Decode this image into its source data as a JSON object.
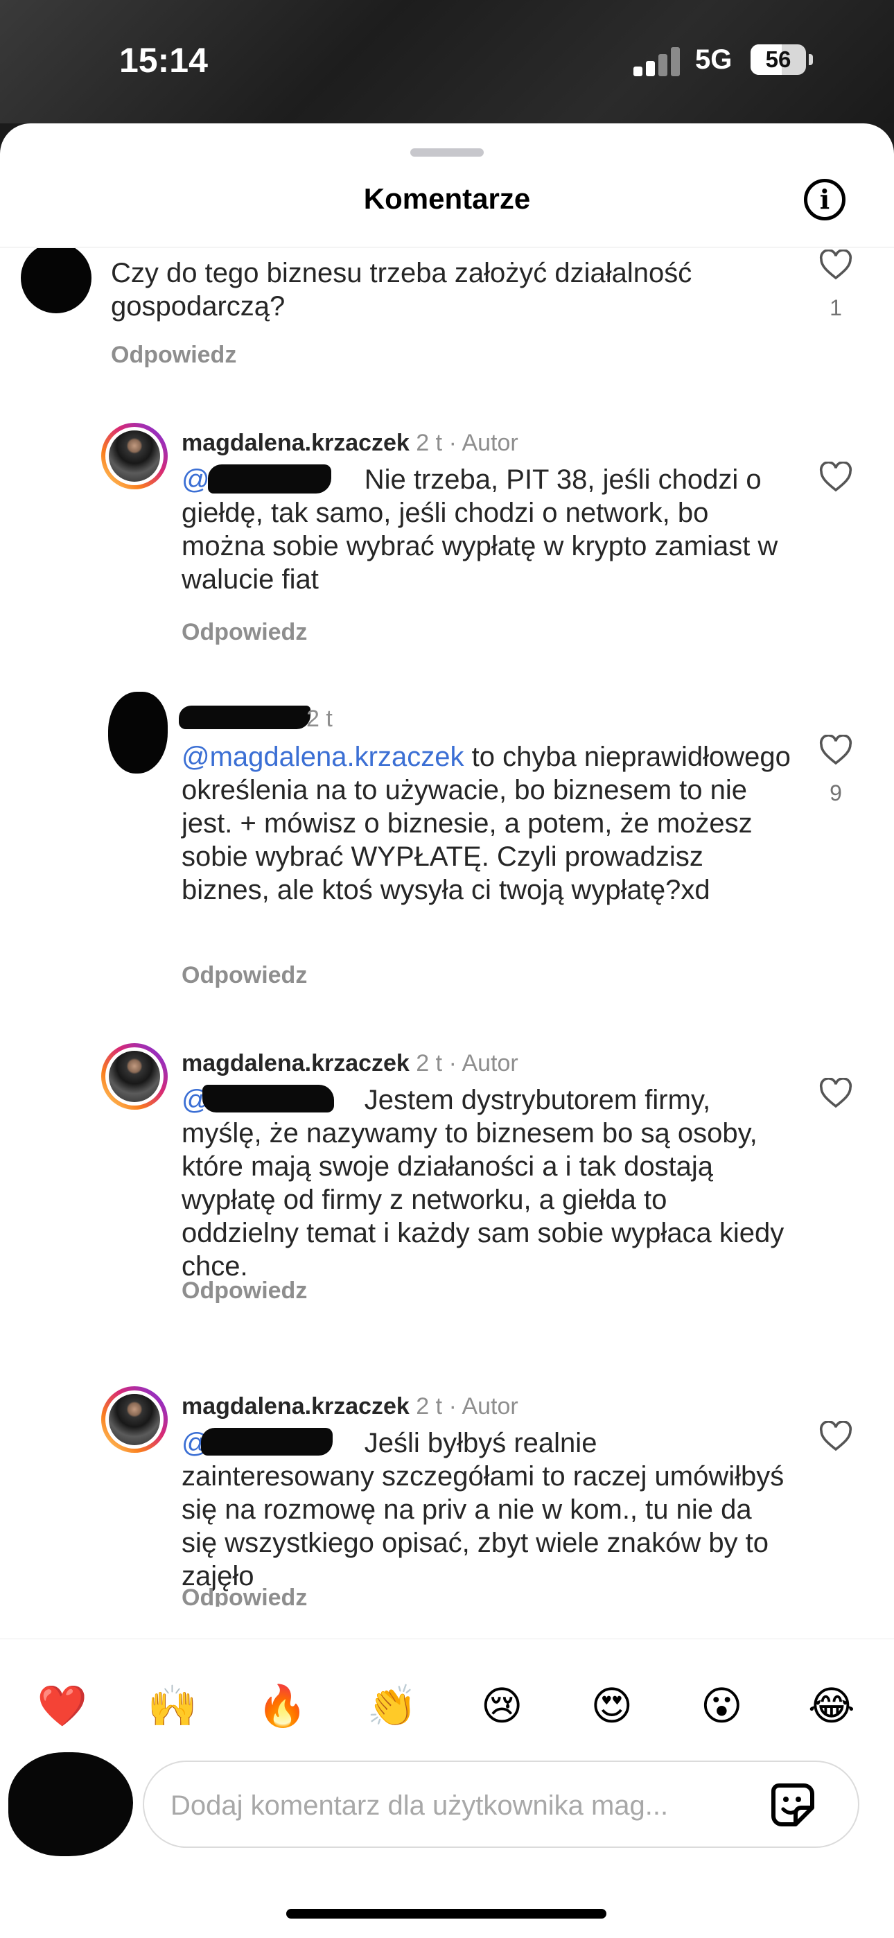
{
  "status_bar": {
    "time": "15:14",
    "network": "5G",
    "battery": "56",
    "battery_level": 0.56
  },
  "header": {
    "title": "Komentarze"
  },
  "comments": [
    {
      "username": "",
      "time": "",
      "text": "Czy do tego biznesu trzeba założyć działalność gospodarczą?",
      "reply_label": "Odpowiedz",
      "likes": "1"
    },
    {
      "username": "magdalena.krzaczek",
      "time": "2 t",
      "author_badge": "· Autor",
      "mention": "@",
      "text": "Nie trzeba, PIT 38, jeśli chodzi o giełdę, tak samo, jeśli chodzi o network, bo można sobie wybrać wypłatę w krypto zamiast w walucie fiat",
      "reply_label": "Odpowiedz",
      "likes": ""
    },
    {
      "username": "",
      "time": "2 t",
      "mention": "@magdalena.krzaczek",
      "text": "to chyba nieprawidłowego określenia na to używacie, bo biznesem to nie jest. + mówisz o biznesie, a potem, że możesz sobie wybrać WYPŁATĘ. Czyli prowadzisz biznes, ale ktoś wysyła ci twoją wypłatę?xd",
      "reply_label": "Odpowiedz",
      "likes": "9"
    },
    {
      "username": "magdalena.krzaczek",
      "time": "2 t",
      "author_badge": "· Autor",
      "mention": "@",
      "text": "Jestem dystrybutorem firmy, myślę, że nazywamy to biznesem bo są osoby, które mają swoje działaności a i tak dostają wypłatę od firmy z networku, a giełda to oddzielny temat i każdy sam sobie wypłaca kiedy chce.",
      "reply_label": "Odpowiedz",
      "likes": ""
    },
    {
      "username": "magdalena.krzaczek",
      "time": "2 t",
      "author_badge": "· Autor",
      "mention": "@",
      "text": "Jeśli byłbyś realnie zainteresowany szczegółami to raczej umówiłbyś się na rozmowę na priv a nie w kom., tu nie da się wszystkiego opisać, zbyt wiele znaków by to zajęło",
      "reply_label": "Odpowiedz",
      "likes": ""
    }
  ],
  "reactions": [
    "❤️",
    "🙌",
    "🔥",
    "👏",
    "😢",
    "😍",
    "😮",
    "😂"
  ],
  "reaction_names": [
    "red-heart",
    "raising-hands",
    "fire",
    "clapping-hands",
    "crying-face",
    "heart-eyes",
    "surprised-face",
    "tears-of-joy"
  ],
  "composer": {
    "placeholder": "Dodaj komentarz dla użytkownika mag..."
  }
}
